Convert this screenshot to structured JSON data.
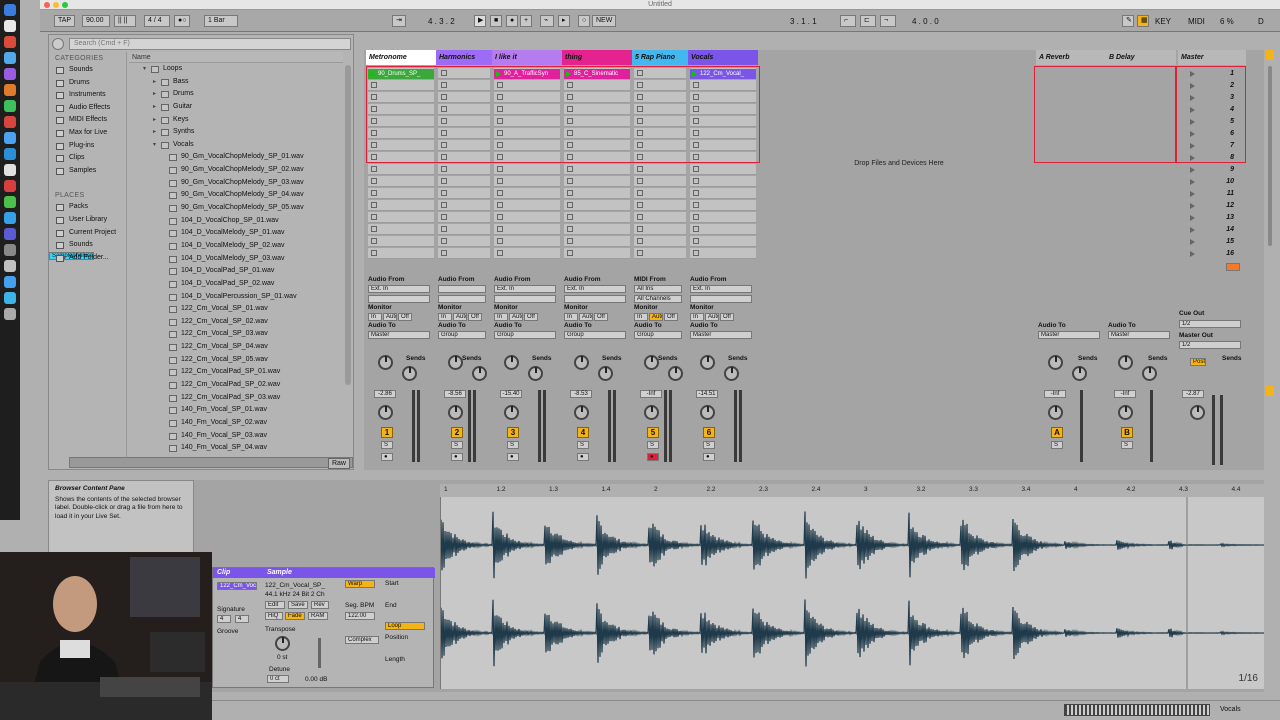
{
  "window": {
    "title": "Untitled"
  },
  "transport": {
    "tap": "TAP",
    "tempo": "90.00",
    "time_sig": "4 / 4",
    "quantize": "1 Bar",
    "position": "4 . 3 . 2",
    "new": "NEW",
    "loop_start": "3 . 1 . 1",
    "loop_length": "4 . 0 . 0",
    "key": "KEY",
    "midi": "MIDI",
    "cpu": "6 %",
    "cpu_d": "D"
  },
  "browser": {
    "search_placeholder": "Search (Cmd + F)",
    "categories_heading": "CATEGORIES",
    "categories": [
      "Sounds",
      "Drums",
      "Instruments",
      "Audio Effects",
      "MIDI Effects",
      "Max for Live",
      "Plug-ins",
      "Clips",
      "Samples"
    ],
    "places_heading": "PLACES",
    "places": [
      "Packs",
      "User Library",
      "Current Project",
      "Sounds",
      "Samplephonics",
      "Add Folder..."
    ],
    "name_column": "Name",
    "folders": [
      "Loops",
      "Bass",
      "Drums",
      "Guitar",
      "Keys",
      "Synths",
      "Vocals"
    ],
    "files": [
      "90_Gm_VocalChopMelody_SP_01.wav",
      "90_Gm_VocalChopMelody_SP_02.wav",
      "90_Gm_VocalChopMelody_SP_03.wav",
      "90_Gm_VocalChopMelody_SP_04.wav",
      "90_Gm_VocalChopMelody_SP_05.wav",
      "104_D_VocalChop_SP_01.wav",
      "104_D_VocalMelody_SP_01.wav",
      "104_D_VocalMelody_SP_02.wav",
      "104_D_VocalMelody_SP_03.wav",
      "104_D_VocalPad_SP_01.wav",
      "104_D_VocalPad_SP_02.wav",
      "104_D_VocalPercussion_SP_01.wav",
      "122_Cm_Vocal_SP_01.wav",
      "122_Cm_Vocal_SP_02.wav",
      "122_Cm_Vocal_SP_03.wav",
      "122_Cm_Vocal_SP_04.wav",
      "122_Cm_Vocal_SP_05.wav",
      "122_Cm_VocalPad_SP_01.wav",
      "122_Cm_VocalPad_SP_02.wav",
      "122_Cm_VocalPad_SP_03.wav",
      "140_Fm_Vocal_SP_01.wav",
      "140_Fm_Vocal_SP_02.wav",
      "140_Fm_Vocal_SP_03.wav",
      "140_Fm_Vocal_SP_04.wav"
    ],
    "raw": "Raw"
  },
  "session": {
    "drop_text": "Drop Files and Devices Here",
    "tracks": [
      {
        "name": "Metronome",
        "color": "#ffffff",
        "clip": "90_Drums_SP_",
        "clip_color": "#3aa83a",
        "num": "1",
        "vol": "-2.86",
        "input": "Ext. In",
        "route": "Master"
      },
      {
        "name": "Harmonics",
        "color": "#9c6cf4",
        "clip": "",
        "clip_color": "",
        "num": "2",
        "vol": "-8.56",
        "input": "",
        "route": "Group"
      },
      {
        "name": "I like it",
        "color": "#b57cf0",
        "clip": "90_A_TrafficSyn",
        "clip_color": "#e0209c",
        "num": "3",
        "vol": "-15.40",
        "input": "Ext. In",
        "route": "Group"
      },
      {
        "name": "thing",
        "color": "#e4238f",
        "clip": "85_C_Sinematic",
        "clip_color": "#e0209c",
        "num": "4",
        "vol": "-8.53",
        "input": "Ext. In",
        "route": "Group"
      },
      {
        "name": "5 Rap Piano",
        "color": "#44b8ee",
        "clip": "",
        "clip_color": "",
        "num": "5",
        "vol": "-Inf",
        "input": "All Ins",
        "route": "Group"
      },
      {
        "name": "Vocals",
        "color": "#7a55e8",
        "clip": "122_Cm_Vocal_",
        "clip_color": "#7a55e8",
        "num": "6",
        "vol": "-14.51",
        "input": "Ext. In",
        "route": "Master"
      }
    ],
    "returns": [
      {
        "name": "A Reverb",
        "letter": "A",
        "vol": "-Inf",
        "route": "Master"
      },
      {
        "name": "B Delay",
        "letter": "B",
        "vol": "-Inf",
        "route": "Master"
      }
    ],
    "master": {
      "name": "Master",
      "vol": "-2.87",
      "cue_out": "Cue Out",
      "cue_val": "1/2",
      "master_out": "Master Out",
      "master_val": "1/2"
    },
    "scenes": [
      "1",
      "2",
      "3",
      "4",
      "5",
      "6",
      "7",
      "8",
      "9",
      "10",
      "11",
      "12",
      "13",
      "14",
      "15",
      "16"
    ],
    "labels": {
      "audio_from": "Audio From",
      "monitor": "Monitor",
      "audio_to": "Audio To",
      "in": "In",
      "auto": "Auto",
      "off": "Off",
      "sends": "Sends",
      "post": "Post",
      "all_channels": "All Channels",
      "midi_from": "MIDI From"
    }
  },
  "detail": {
    "info_title": "Browser Content Pane",
    "info_text": "Shows the contents of the selected browser label. Double-click or drag a file from here to load it in your Live Set.",
    "clip_tab": "Clip",
    "sample_tab": "Sample",
    "clip_name": "122_Cm_Vocal",
    "sample_name": "122_Cm_Vocal_SP_",
    "sample_info": "44.1 kHz 24 Bit 2 Ch",
    "warp": "Warp",
    "edit": "Edit",
    "save": "Save",
    "rev": "Rev",
    "hiq": "HiQ",
    "fade": "Fade",
    "ram": "RAM",
    "seg_bpm": "Seg. BPM",
    "bpm": "122.00",
    "complex": "Complex",
    "start": "Start",
    "end": "End",
    "loop": "Loop",
    "position": "Position",
    "length": "Length",
    "signature": "Signature",
    "groove": "Groove",
    "transpose": "Transpose",
    "detune": "Detune",
    "semitone": "0 st",
    "cents": "0 ct",
    "gain": "0.00 dB",
    "sig_num": "4",
    "sig_den": "4",
    "ruler": [
      "1",
      "1.2",
      "1.3",
      "1.4",
      "2",
      "2.2",
      "2.3",
      "2.4",
      "3",
      "3.2",
      "3.3",
      "3.4",
      "4",
      "4.2",
      "4.3",
      "4.4"
    ],
    "pager": "1/16"
  },
  "status": {
    "track": "Vocals"
  }
}
